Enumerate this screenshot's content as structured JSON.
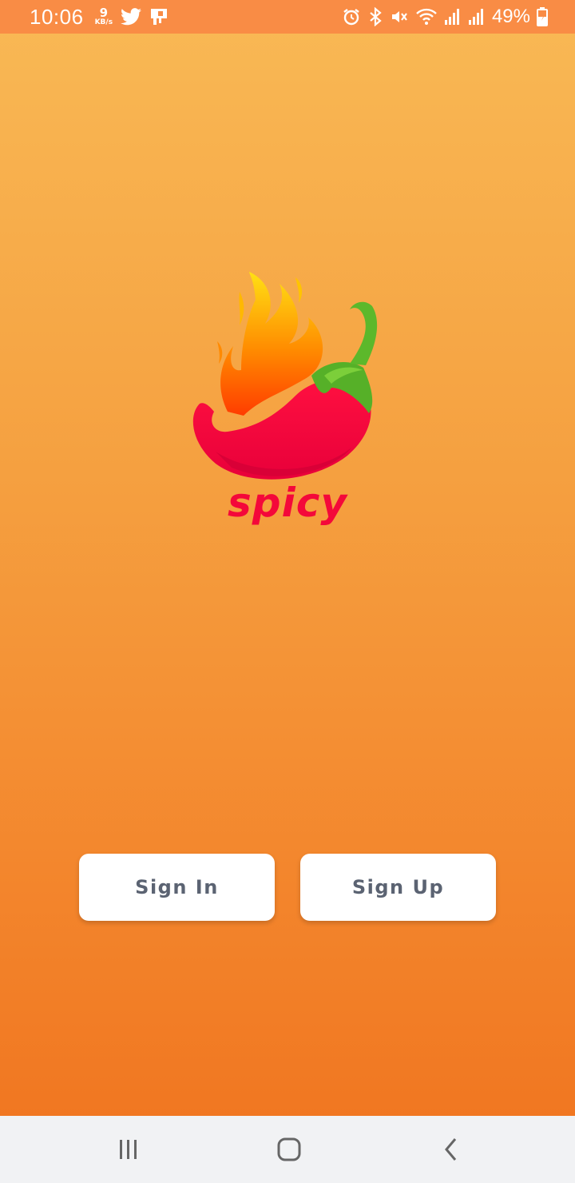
{
  "status_bar": {
    "time": "10:06",
    "net_speed_value": "9",
    "net_speed_unit": "KB/s",
    "left_icons": [
      "twitter-icon",
      "notification-card-icon"
    ],
    "right_icons": [
      "alarm-icon",
      "bluetooth-icon",
      "mute-icon",
      "wifi-icon",
      "signal-icon",
      "signal-icon"
    ],
    "battery": "49%"
  },
  "brand": {
    "name": "spicy",
    "colors": {
      "red": "#f4083a",
      "orange": "#ff5a00",
      "yellow": "#ffd21f",
      "green": "#56b028"
    }
  },
  "actions": {
    "sign_in_label": "Sign In",
    "sign_up_label": "Sign Up"
  },
  "nav_bar": {
    "icons": [
      "recent-apps-icon",
      "home-icon",
      "back-icon"
    ]
  }
}
